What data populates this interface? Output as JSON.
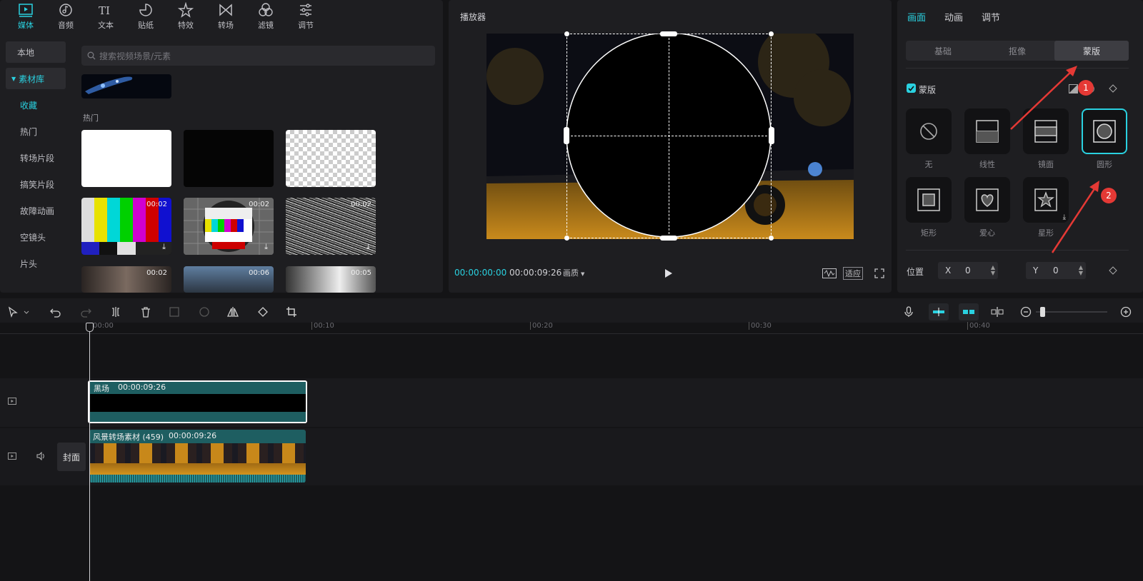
{
  "media_tabs": [
    {
      "label": "媒体",
      "icon": "media-icon"
    },
    {
      "label": "音频",
      "icon": "audio-icon"
    },
    {
      "label": "文本",
      "icon": "text-icon"
    },
    {
      "label": "贴纸",
      "icon": "sticker-icon"
    },
    {
      "label": "特效",
      "icon": "effects-icon"
    },
    {
      "label": "转场",
      "icon": "transition-icon"
    },
    {
      "label": "滤镜",
      "icon": "filter-icon"
    },
    {
      "label": "调节",
      "icon": "adjust-icon"
    }
  ],
  "sidebar": {
    "local": "本地",
    "library": "素材库",
    "items": [
      "收藏",
      "热门",
      "转场片段",
      "搞笑片段",
      "故障动画",
      "空镜头",
      "片头"
    ]
  },
  "search": {
    "placeholder": "搜索视频场景/元素"
  },
  "section_hot": "热门",
  "thumbs": {
    "row2": [
      "00:02",
      "00:02",
      "00:02"
    ],
    "row3": [
      "00:02",
      "00:06",
      "00:05"
    ]
  },
  "player": {
    "title": "播放器",
    "current": "00:00:00:00",
    "total": "00:00:09:26",
    "quality": "画质",
    "fit": "适应"
  },
  "inspector": {
    "tabs": [
      "画面",
      "动画",
      "调节"
    ],
    "subtabs": [
      "基础",
      "抠像",
      "蒙版"
    ],
    "mask_label": "蒙版",
    "masks": [
      "无",
      "线性",
      "镜面",
      "圆形",
      "矩形",
      "爱心",
      "星形"
    ],
    "position_label": "位置",
    "x_label": "X",
    "x_value": "0",
    "y_label": "Y",
    "y_value": "0"
  },
  "annotations": [
    "1",
    "2"
  ],
  "ruler": [
    "00:00",
    "00:10",
    "00:20",
    "00:30",
    "00:40"
  ],
  "timeline": {
    "clip1_name": "黑场",
    "clip1_dur": "00:00:09:26",
    "clip2_name": "风景转场素材 (459)",
    "clip2_dur": "00:00:09:26",
    "cover": "封面"
  },
  "colors": {
    "accent": "#2ad1e0",
    "clip": "#1e5e61",
    "badge": "#e53935"
  }
}
